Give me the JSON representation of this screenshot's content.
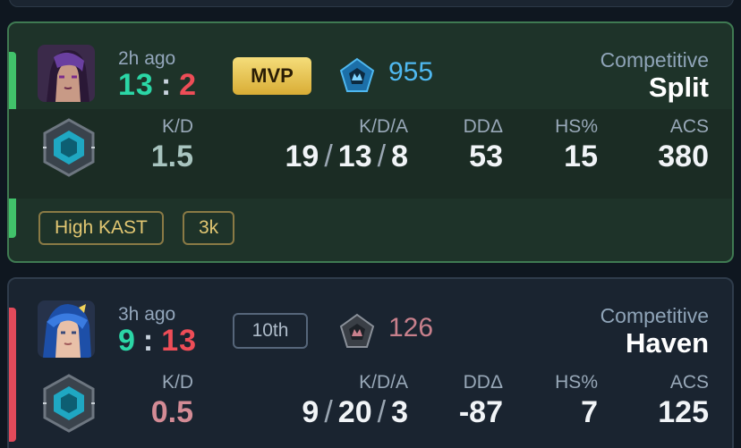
{
  "matches": [
    {
      "result": "win",
      "time_ago": "2h ago",
      "score_team": "13",
      "score_sep": ":",
      "score_enemy": "2",
      "badge": "MVP",
      "rank_icon": "rank-emblem-icon",
      "rr": "955",
      "mode": "Competitive",
      "map": "Split",
      "stats": {
        "kd_label": "K/D",
        "kd": "1.5",
        "kda_label": "K/D/A",
        "kills": "19",
        "deaths": "13",
        "assists": "8",
        "dd_label": "DDΔ",
        "dd": "53",
        "hs_label": "HS%",
        "hs": "15",
        "acs_label": "ACS",
        "acs": "380"
      },
      "tags": [
        "High KAST",
        "3k"
      ]
    },
    {
      "result": "loss",
      "time_ago": "3h ago",
      "score_team": "9",
      "score_sep": ":",
      "score_enemy": "13",
      "badge": "10th",
      "rank_icon": "rank-emblem-icon",
      "rr": "126",
      "mode": "Competitive",
      "map": "Haven",
      "stats": {
        "kd_label": "K/D",
        "kd": "0.5",
        "kda_label": "K/D/A",
        "kills": "9",
        "deaths": "20",
        "assists": "3",
        "dd_label": "DDΔ",
        "dd": "-87",
        "hs_label": "HS%",
        "hs": "7",
        "acs_label": "ACS",
        "acs": "125"
      }
    }
  ],
  "colors": {
    "win_accent": "#41c26a",
    "loss_accent": "#e24a5a",
    "score_win": "#2bd6a6",
    "score_loss": "#ee4d57",
    "mvp_gold": "#e6c154"
  }
}
